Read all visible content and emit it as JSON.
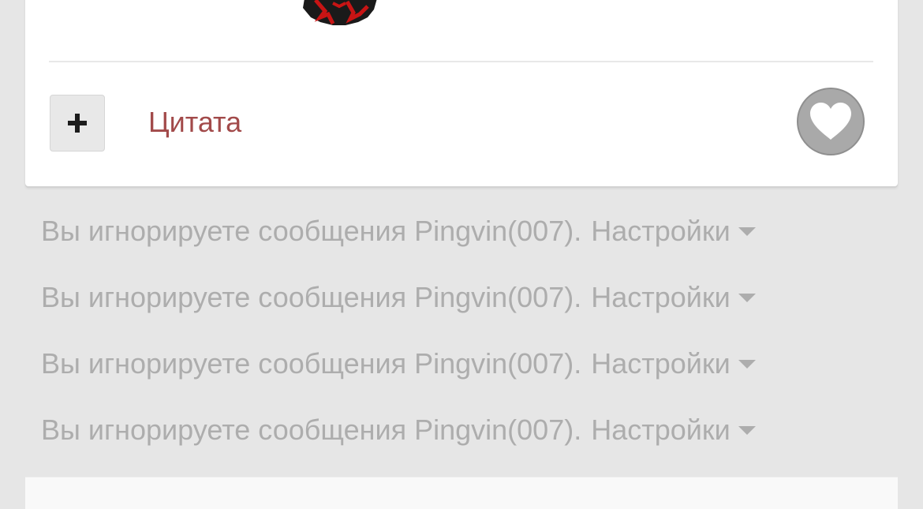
{
  "post": {
    "quote_label": "Цитата",
    "expand_icon": "plus-icon",
    "like_icon": "heart-icon"
  },
  "ignored_posts": [
    {
      "text": "Вы игнорируете сообщения Pingvin(007).",
      "settings_label": "Настройки"
    },
    {
      "text": "Вы игнорируете сообщения Pingvin(007).",
      "settings_label": "Настройки"
    },
    {
      "text": "Вы игнорируете сообщения Pingvin(007).",
      "settings_label": "Настройки"
    },
    {
      "text": "Вы игнорируете сообщения Pingvin(007).",
      "settings_label": "Настройки"
    }
  ],
  "colors": {
    "background": "#e6e6e6",
    "card": "#ffffff",
    "quote_link": "#a24a4a",
    "muted_text": "#adadad",
    "like_button": "#a9a9a9"
  }
}
